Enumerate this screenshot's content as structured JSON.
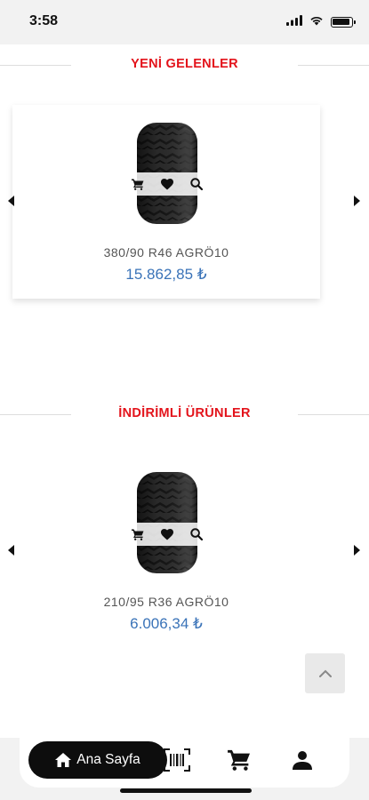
{
  "status_bar": {
    "time": "3:58"
  },
  "sections": [
    {
      "title": "YENİ GELENLER",
      "product": {
        "name": "380/90 R46 AGRÖ10",
        "price": "15.862,85 ₺"
      }
    },
    {
      "title": "İNDİRİMLİ ÜRÜNLER",
      "product": {
        "name": "210/95 R36 AGRÖ10",
        "price": "6.006,34 ₺"
      }
    }
  ],
  "bottom_nav": {
    "home_label": "Ana Sayfa",
    "items": [
      {
        "icon": "home-icon"
      },
      {
        "icon": "barcode-scan-icon"
      },
      {
        "icon": "cart-icon"
      },
      {
        "icon": "user-icon"
      }
    ]
  },
  "colors": {
    "section_title": "#e3131b",
    "price": "#3a73b8",
    "nav_active": "#0d0d0d"
  },
  "icons": [
    "cart-icon",
    "heart-icon",
    "search-icon",
    "chevron-left-icon",
    "chevron-right-icon",
    "chevron-up-icon"
  ]
}
